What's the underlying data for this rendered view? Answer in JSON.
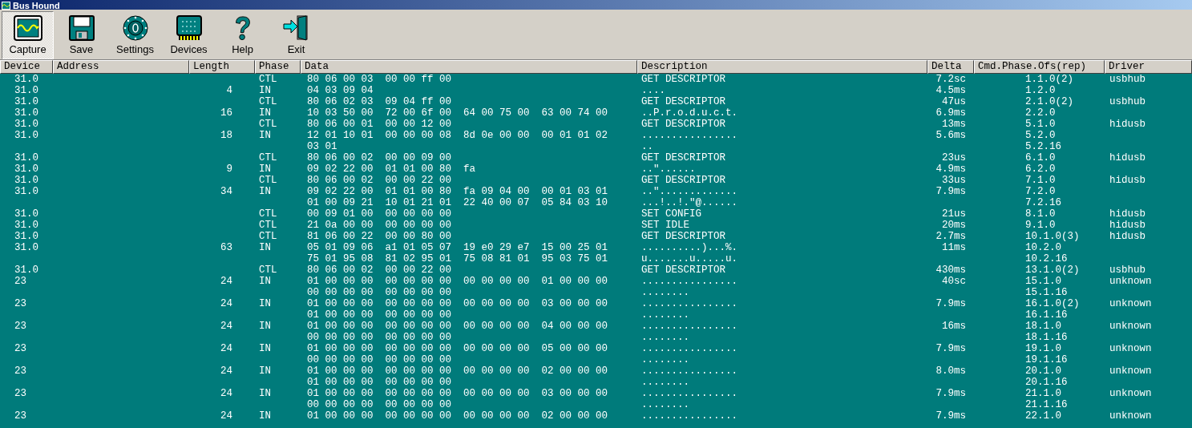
{
  "window": {
    "title": "Bus Hound"
  },
  "toolbar": {
    "buttons": [
      {
        "kind": "capture",
        "label": "Capture",
        "selected": true
      },
      {
        "kind": "save",
        "label": "Save",
        "selected": false
      },
      {
        "kind": "settings",
        "label": "Settings",
        "selected": false
      },
      {
        "kind": "devices",
        "label": "Devices",
        "selected": false
      },
      {
        "kind": "help",
        "label": "Help",
        "selected": false
      },
      {
        "kind": "exit",
        "label": "Exit",
        "selected": false
      }
    ]
  },
  "table": {
    "columns": [
      "Device",
      "Address",
      "Length",
      "Phase",
      "Data",
      "Description",
      "Delta",
      "Cmd.Phase.Ofs(rep)",
      "Driver"
    ],
    "rows": [
      {
        "device": "31.0",
        "phase": "CTL",
        "data": [
          "80 06 00 03  00 00 ff 00"
        ],
        "description": [
          "GET DESCRIPTOR"
        ],
        "delta": "7.2sc",
        "cmd": [
          "1.1.0(2)"
        ],
        "driver": "usbhub"
      },
      {
        "device": "31.0",
        "length": "4",
        "phase": "IN",
        "data": [
          "04 03 09 04"
        ],
        "description": [
          "...."
        ],
        "delta": "4.5ms",
        "cmd": [
          "1.2.0"
        ]
      },
      {
        "device": "31.0",
        "phase": "CTL",
        "data": [
          "80 06 02 03  09 04 ff 00"
        ],
        "description": [
          "GET DESCRIPTOR"
        ],
        "delta": "47us",
        "cmd": [
          "2.1.0(2)"
        ],
        "driver": "usbhub"
      },
      {
        "device": "31.0",
        "length": "16",
        "phase": "IN",
        "data": [
          "10 03 50 00  72 00 6f 00  64 00 75 00  63 00 74 00"
        ],
        "description": [
          "..P.r.o.d.u.c.t."
        ],
        "delta": "6.9ms",
        "cmd": [
          "2.2.0"
        ]
      },
      {
        "device": "31.0",
        "phase": "CTL",
        "data": [
          "80 06 00 01  00 00 12 00"
        ],
        "description": [
          "GET DESCRIPTOR"
        ],
        "delta": "13ms",
        "cmd": [
          "5.1.0"
        ],
        "driver": "hidusb"
      },
      {
        "device": "31.0",
        "length": "18",
        "phase": "IN",
        "data": [
          "12 01 10 01  00 00 00 08  8d 0e 00 00  00 01 01 02",
          "03 01"
        ],
        "description": [
          "................",
          ".."
        ],
        "delta": "5.6ms",
        "cmd": [
          "5.2.0",
          "5.2.16"
        ]
      },
      {
        "device": "31.0",
        "phase": "CTL",
        "data": [
          "80 06 00 02  00 00 09 00"
        ],
        "description": [
          "GET DESCRIPTOR"
        ],
        "delta": "23us",
        "cmd": [
          "6.1.0"
        ],
        "driver": "hidusb"
      },
      {
        "device": "31.0",
        "length": "9",
        "phase": "IN",
        "data": [
          "09 02 22 00  01 01 00 80  fa"
        ],
        "description": [
          "..\"......"
        ],
        "delta": "4.9ms",
        "cmd": [
          "6.2.0"
        ]
      },
      {
        "device": "31.0",
        "phase": "CTL",
        "data": [
          "80 06 00 02  00 00 22 00"
        ],
        "description": [
          "GET DESCRIPTOR"
        ],
        "delta": "33us",
        "cmd": [
          "7.1.0"
        ],
        "driver": "hidusb"
      },
      {
        "device": "31.0",
        "length": "34",
        "phase": "IN",
        "data": [
          "09 02 22 00  01 01 00 80  fa 09 04 00  00 01 03 01",
          "01 00 09 21  10 01 21 01  22 40 00 07  05 84 03 10"
        ],
        "description": [
          "..\".............",
          "...!..!.\"@......"
        ],
        "delta": "7.9ms",
        "cmd": [
          "7.2.0",
          "7.2.16"
        ]
      },
      {
        "device": "31.0",
        "phase": "CTL",
        "data": [
          "00 09 01 00  00 00 00 00"
        ],
        "description": [
          "SET CONFIG"
        ],
        "delta": "21us",
        "cmd": [
          "8.1.0"
        ],
        "driver": "hidusb"
      },
      {
        "device": "31.0",
        "phase": "CTL",
        "data": [
          "21 0a 00 00  00 00 00 00"
        ],
        "description": [
          "SET IDLE"
        ],
        "delta": "20ms",
        "cmd": [
          "9.1.0"
        ],
        "driver": "hidusb"
      },
      {
        "device": "31.0",
        "phase": "CTL",
        "data": [
          "81 06 00 22  00 00 80 00"
        ],
        "description": [
          "GET DESCRIPTOR"
        ],
        "delta": "2.7ms",
        "cmd": [
          "10.1.0(3)"
        ],
        "driver": "hidusb"
      },
      {
        "device": "31.0",
        "length": "63",
        "phase": "IN",
        "data": [
          "05 01 09 06  a1 01 05 07  19 e0 29 e7  15 00 25 01",
          "75 01 95 08  81 02 95 01  75 08 81 01  95 03 75 01"
        ],
        "description": [
          "..........)...%.",
          "u.......u.....u."
        ],
        "delta": "11ms",
        "cmd": [
          "10.2.0",
          "10.2.16"
        ]
      },
      {
        "device": "31.0",
        "phase": "CTL",
        "data": [
          "80 06 00 02  00 00 22 00"
        ],
        "description": [
          "GET DESCRIPTOR"
        ],
        "delta": "430ms",
        "cmd": [
          "13.1.0(2)"
        ],
        "driver": "usbhub"
      },
      {
        "device": "23",
        "length": "24",
        "phase": "IN",
        "data": [
          "01 00 00 00  00 00 00 00  00 00 00 00  01 00 00 00",
          "00 00 00 00  00 00 00 00"
        ],
        "description": [
          "................",
          "........"
        ],
        "delta": "40sc",
        "cmd": [
          "15.1.0",
          "15.1.16"
        ],
        "driver": "unknown"
      },
      {
        "device": "23",
        "length": "24",
        "phase": "IN",
        "data": [
          "01 00 00 00  00 00 00 00  00 00 00 00  03 00 00 00",
          "01 00 00 00  00 00 00 00"
        ],
        "description": [
          "................",
          "........"
        ],
        "delta": "7.9ms",
        "cmd": [
          "16.1.0(2)",
          "16.1.16"
        ],
        "driver": "unknown"
      },
      {
        "device": "23",
        "length": "24",
        "phase": "IN",
        "data": [
          "01 00 00 00  00 00 00 00  00 00 00 00  04 00 00 00",
          "00 00 00 00  00 00 00 00"
        ],
        "description": [
          "................",
          "........"
        ],
        "delta": "16ms",
        "cmd": [
          "18.1.0",
          "18.1.16"
        ],
        "driver": "unknown"
      },
      {
        "device": "23",
        "length": "24",
        "phase": "IN",
        "data": [
          "01 00 00 00  00 00 00 00  00 00 00 00  05 00 00 00",
          "00 00 00 00  00 00 00 00"
        ],
        "description": [
          "................",
          "........"
        ],
        "delta": "7.9ms",
        "cmd": [
          "19.1.0",
          "19.1.16"
        ],
        "driver": "unknown"
      },
      {
        "device": "23",
        "length": "24",
        "phase": "IN",
        "data": [
          "01 00 00 00  00 00 00 00  00 00 00 00  02 00 00 00",
          "01 00 00 00  00 00 00 00"
        ],
        "description": [
          "................",
          "........"
        ],
        "delta": "8.0ms",
        "cmd": [
          "20.1.0",
          "20.1.16"
        ],
        "driver": "unknown"
      },
      {
        "device": "23",
        "length": "24",
        "phase": "IN",
        "data": [
          "01 00 00 00  00 00 00 00  00 00 00 00  03 00 00 00",
          "00 00 00 00  00 00 00 00"
        ],
        "description": [
          "................",
          "........"
        ],
        "delta": "7.9ms",
        "cmd": [
          "21.1.0",
          "21.1.16"
        ],
        "driver": "unknown"
      },
      {
        "device": "23",
        "length": "24",
        "phase": "IN",
        "data": [
          "01 00 00 00  00 00 00 00  00 00 00 00  02 00 00 00"
        ],
        "description": [
          "................"
        ],
        "delta": "7.9ms",
        "cmd": [
          "22.1.0"
        ],
        "driver": "unknown"
      }
    ]
  }
}
